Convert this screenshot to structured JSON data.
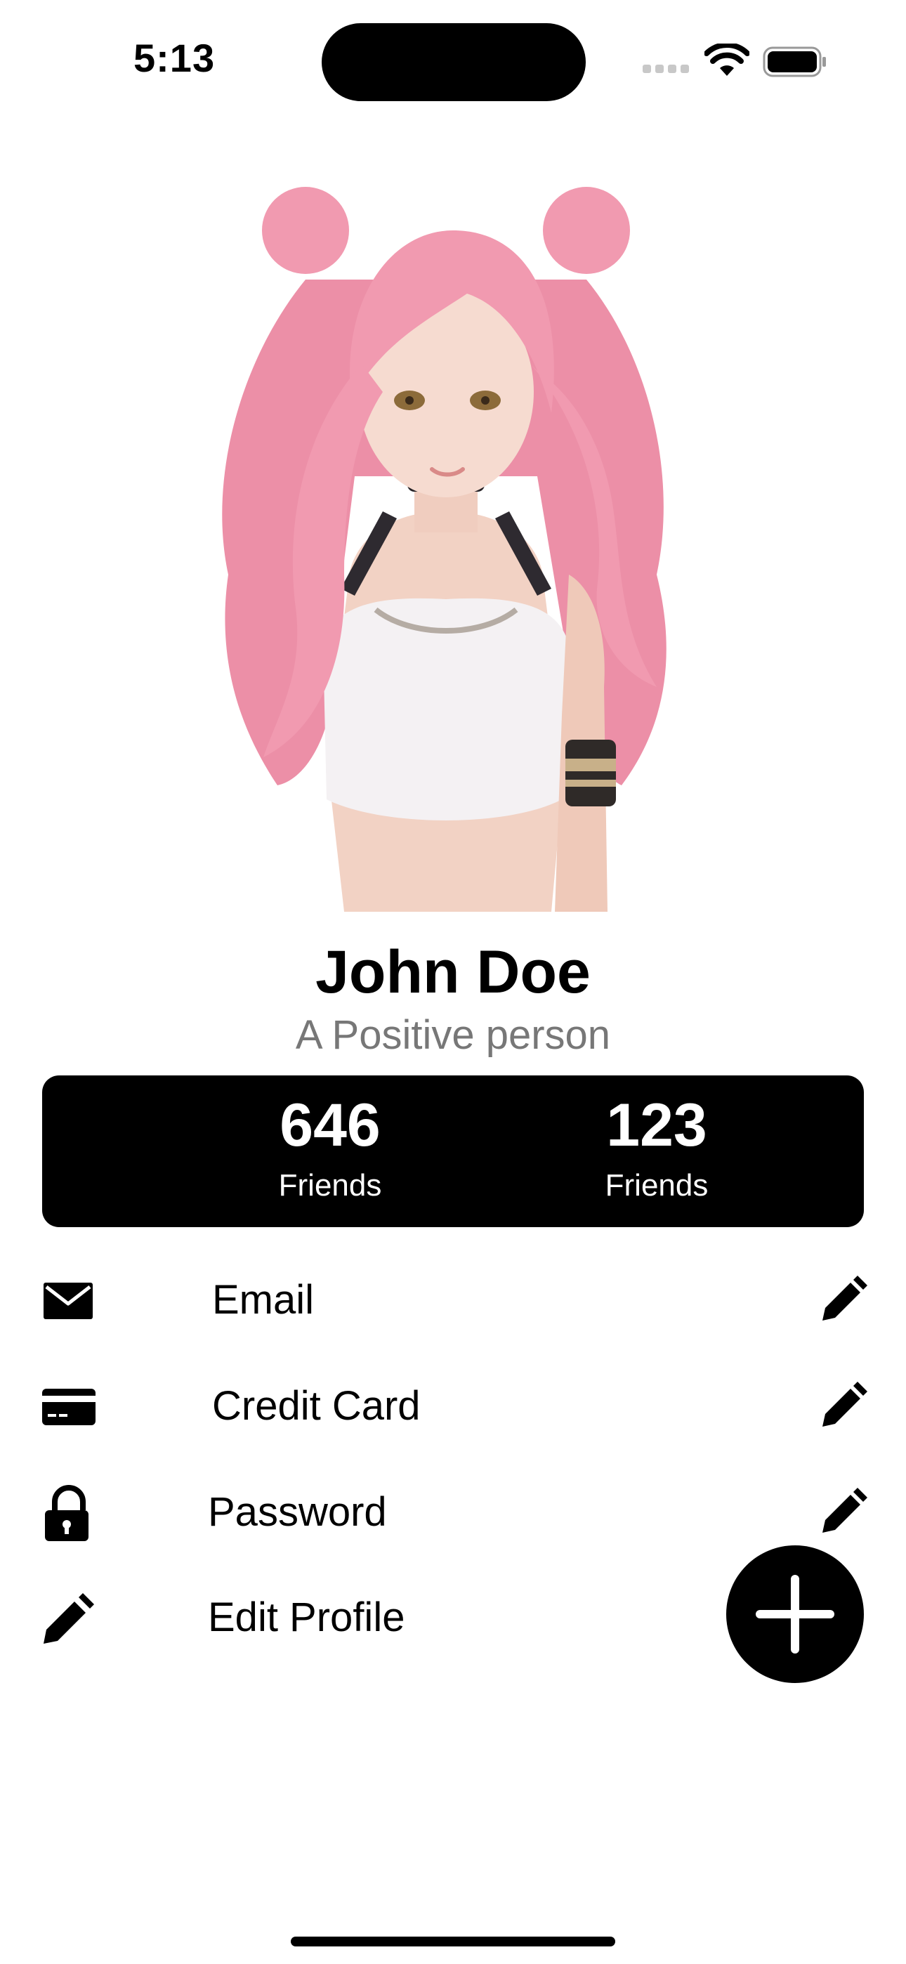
{
  "status_bar": {
    "time": "5:13"
  },
  "profile": {
    "name": "John Doe",
    "bio": "A Positive person"
  },
  "stats": [
    {
      "value": "646",
      "label": "Friends"
    },
    {
      "value": "123",
      "label": "Friends"
    }
  ],
  "menu": [
    {
      "label": "Email",
      "icon": "envelope-icon",
      "action_icon": "pencil-icon"
    },
    {
      "label": "Credit Card",
      "icon": "credit-card-icon",
      "action_icon": "pencil-icon"
    },
    {
      "label": "Password",
      "icon": "lock-icon",
      "action_icon": "pencil-icon"
    },
    {
      "label": "Edit Profile",
      "icon": "pencil-icon"
    }
  ],
  "fab": {
    "icon": "plus-icon"
  },
  "colors": {
    "background": "#ffffff",
    "card": "#000000",
    "bio_text": "#777777",
    "hair": "#f19ab0"
  }
}
